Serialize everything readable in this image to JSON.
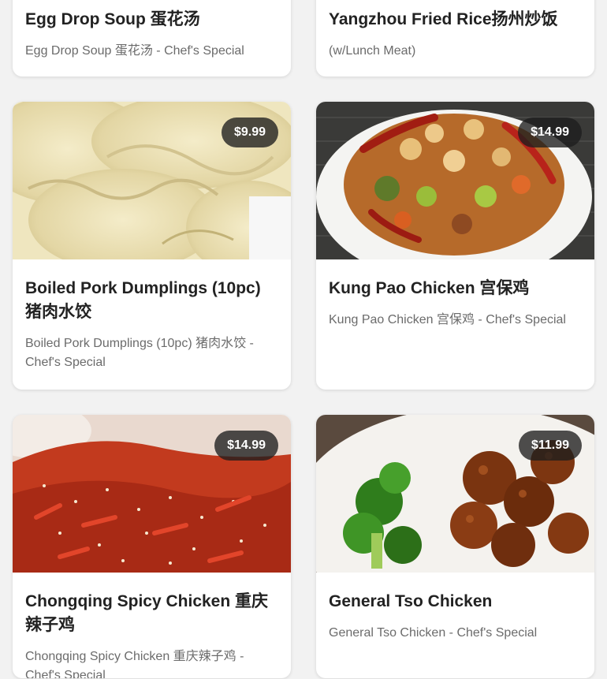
{
  "menu_items": [
    {
      "title": "Egg Drop Soup 蛋花汤",
      "description": "Egg Drop Soup 蛋花汤 - Chef's Special"
    },
    {
      "title": "Yangzhou Fried Rice扬州炒饭",
      "description": "(w/Lunch Meat)"
    },
    {
      "title": "Boiled Pork Dumplings (10pc) 猪肉水饺",
      "description": "Boiled Pork Dumplings (10pc) 猪肉水饺 - Chef's Special",
      "price": "$9.99",
      "image": "dumplings-photo"
    },
    {
      "title": "Kung Pao Chicken 宫保鸡",
      "description": "Kung Pao Chicken 宫保鸡 - Chef's Special",
      "price": "$14.99",
      "image": "kung-pao-chicken-photo"
    },
    {
      "title": "Chongqing Spicy Chicken 重庆辣子鸡",
      "description": "Chongqing Spicy Chicken 重庆辣子鸡 - Chef's Special",
      "price": "$14.99",
      "image": "spicy-chicken-photo"
    },
    {
      "title": "General Tso Chicken",
      "description": "General Tso Chicken - Chef's Special",
      "price": "$11.99",
      "image": "general-tso-chicken-photo"
    }
  ]
}
